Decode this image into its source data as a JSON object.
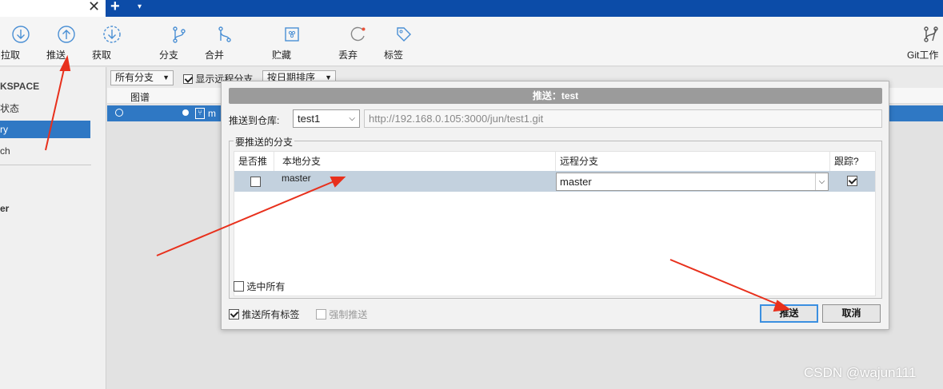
{
  "tabbar": {
    "close_glyph": "✕",
    "plus_glyph": "+",
    "caret_glyph": "▾"
  },
  "toolbar": {
    "items": [
      {
        "label": "拉取",
        "icon": "pull-icon"
      },
      {
        "label": "推送",
        "icon": "push-icon"
      },
      {
        "label": "获取",
        "icon": "fetch-icon"
      },
      {
        "label": "分支",
        "icon": "branch-icon"
      },
      {
        "label": "合并",
        "icon": "merge-icon"
      },
      {
        "label": "贮藏",
        "icon": "stash-icon"
      },
      {
        "label": "丢弃",
        "icon": "discard-icon"
      },
      {
        "label": "标签",
        "icon": "tag-icon"
      },
      {
        "label": "Git工作",
        "icon": "git-flow-icon"
      }
    ]
  },
  "sidebar": {
    "items": [
      {
        "label": "KSPACE"
      },
      {
        "label": "状态"
      },
      {
        "label": "ry"
      },
      {
        "label": "ch"
      },
      {
        "label": "er"
      }
    ]
  },
  "filterbar": {
    "branches_select": "所有分支",
    "show_remote_label": "显示远程分支",
    "sort_select": "按日期排序",
    "graph_header": "图谱",
    "row_text": "m"
  },
  "dialog": {
    "title": "推送：test",
    "push_to_repo_label": "推送到仓库:",
    "repo_value": "test1",
    "repo_url": "http://192.168.0.105:3000/jun/test1.git",
    "group_label": "要推送的分支",
    "columns": {
      "push": "是否推",
      "local": "本地分支",
      "remote": "远程分支",
      "track": "跟踪?"
    },
    "row": {
      "local": "master",
      "remote": "master",
      "push_checked": false,
      "track_checked": true
    },
    "select_all_label": "选中所有",
    "push_all_tags_label": "推送所有标签",
    "force_push_label": "强制推送",
    "push_button": "推送",
    "cancel_button": "取消"
  },
  "watermark": "CSDN @wajun111",
  "colors": {
    "accent": "#0c4ca8",
    "selection": "#2f78c4",
    "arrow": "#e8301c"
  }
}
